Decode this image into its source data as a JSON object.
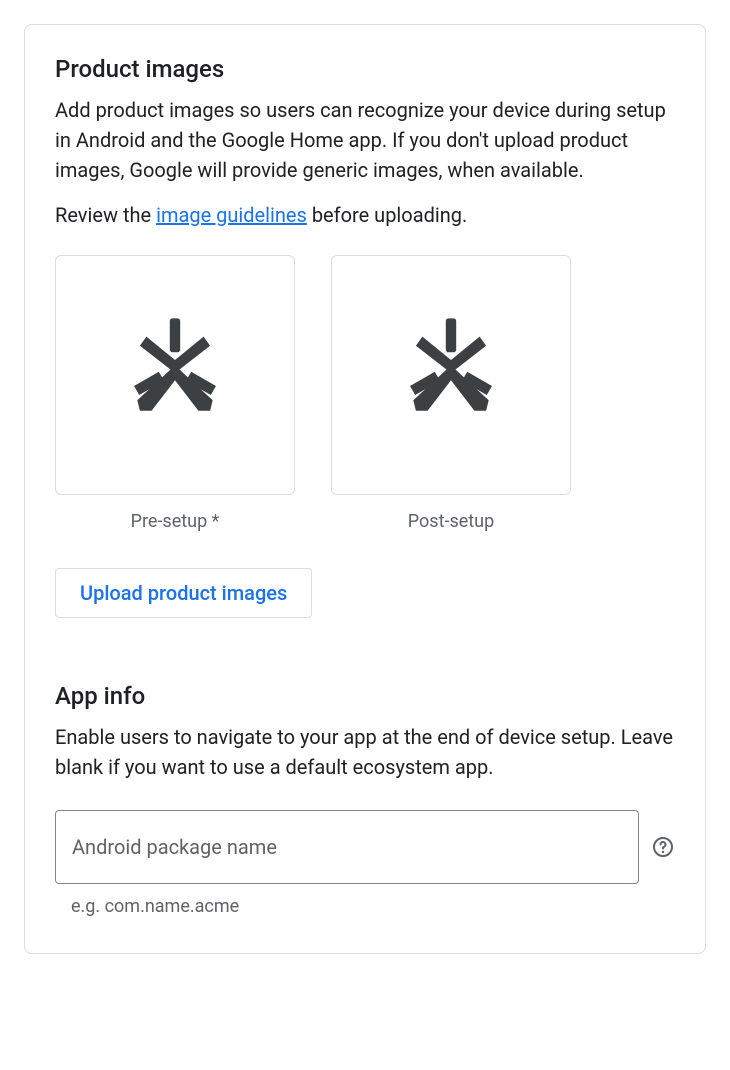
{
  "productImages": {
    "title": "Product images",
    "description": "Add product images so users can recognize your device during setup in Android and the Google Home app. If you don't upload product images, Google will provide generic images, when available.",
    "reviewPrefix": "Review the ",
    "reviewLinkText": "image guidelines",
    "reviewSuffix": " before uploading.",
    "slots": [
      {
        "caption": "Pre-setup *"
      },
      {
        "caption": "Post-setup"
      }
    ],
    "uploadButton": "Upload product images"
  },
  "appInfo": {
    "title": "App info",
    "description": "Enable users to navigate to your app at the end of device setup. Leave blank if you want to use a default ecosystem app.",
    "field": {
      "placeholder": "Android package name",
      "value": "",
      "hint": "e.g. com.name.acme"
    }
  }
}
